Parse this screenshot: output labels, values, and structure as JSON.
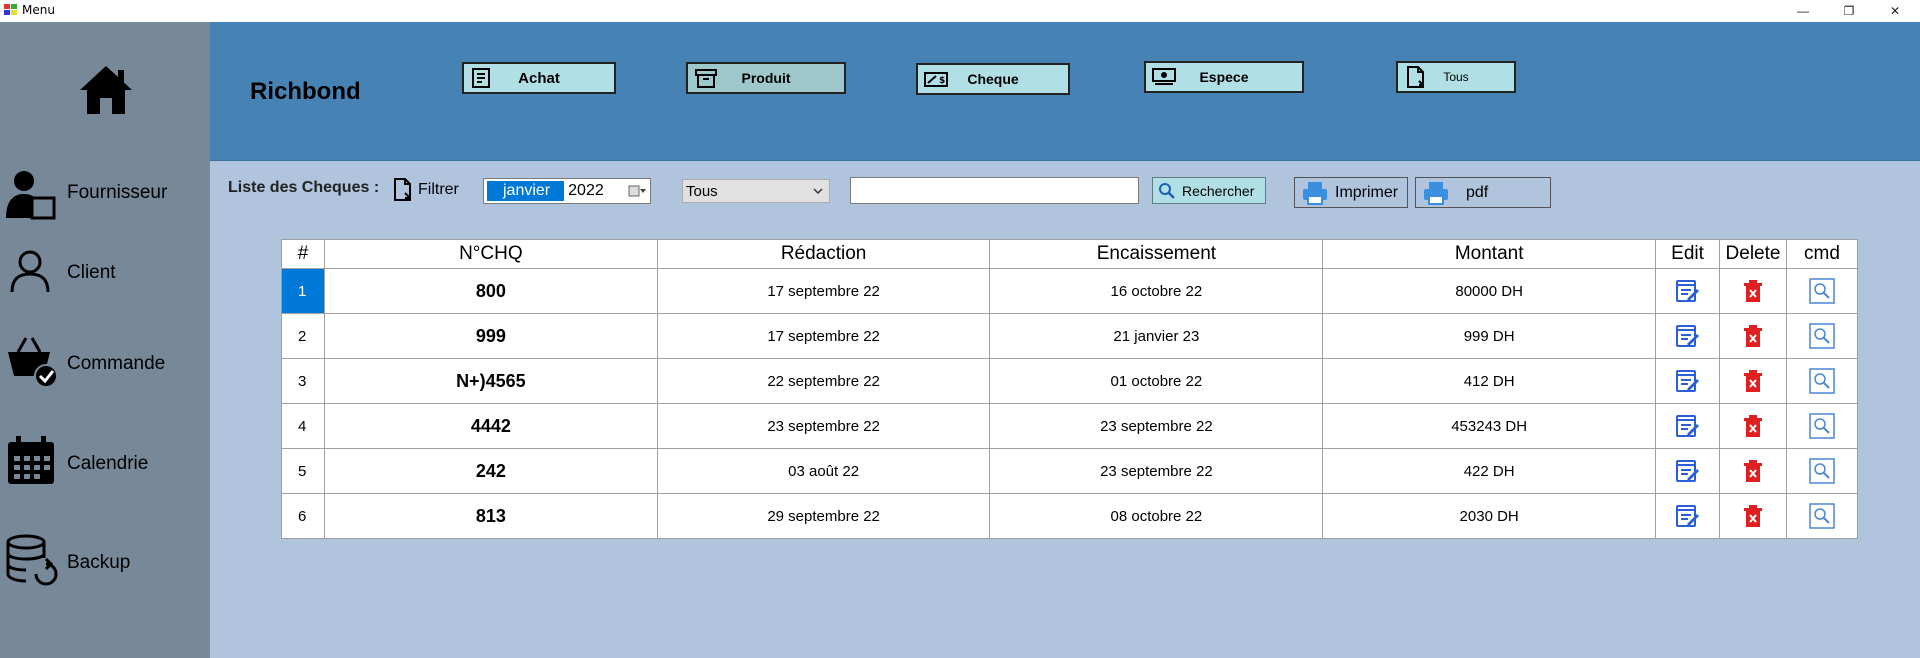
{
  "window": {
    "title": "Menu",
    "controls": [
      "—",
      "❐",
      "✕"
    ]
  },
  "sidebar": {
    "home_icon": "home-icon",
    "items": [
      {
        "label": "Fournisseur",
        "icon": "supplier-icon"
      },
      {
        "label": "Client",
        "icon": "user-icon"
      },
      {
        "label": "Commande",
        "icon": "basket-check-icon"
      },
      {
        "label": "Calendrie",
        "icon": "calendar-icon"
      },
      {
        "label": "Backup",
        "icon": "database-sync-icon"
      }
    ]
  },
  "header": {
    "brand": "Richbond",
    "buttons": [
      {
        "label": "Achat",
        "icon": "receipt-icon",
        "active": false
      },
      {
        "label": "Produit",
        "icon": "archive-icon",
        "active": true
      },
      {
        "label": "Cheque",
        "icon": "cheque-icon",
        "active": false
      },
      {
        "label": "Espece",
        "icon": "cash-icon",
        "active": false
      },
      {
        "label": "Tous",
        "icon": "document-icon",
        "active": false
      }
    ]
  },
  "toolbar": {
    "list_label": "Liste des Cheques :",
    "filter_label": "Filtrer",
    "date": {
      "month": "janvier",
      "year": "2022"
    },
    "type_select": "Tous",
    "search_value": "",
    "search_button": "Rechercher",
    "print_button": "Imprimer",
    "pdf_button": "pdf"
  },
  "grid": {
    "columns": [
      "#",
      "N°CHQ",
      "Rédaction",
      "Encaissement",
      "Montant",
      "Edit",
      "Delete",
      "cmd"
    ],
    "rows": [
      {
        "idx": "1",
        "num": "800",
        "redaction": "17 septembre 22",
        "encaissement": "16 octobre 22",
        "montant": "80000 DH"
      },
      {
        "idx": "2",
        "num": "999",
        "redaction": "17 septembre 22",
        "encaissement": "21 janvier 23",
        "montant": "999 DH"
      },
      {
        "idx": "3",
        "num": "N+)4565",
        "redaction": "22 septembre 22",
        "encaissement": "01 octobre 22",
        "montant": "412 DH"
      },
      {
        "idx": "4",
        "num": "4442",
        "redaction": "23 septembre 22",
        "encaissement": "23 septembre 22",
        "montant": "453243 DH"
      },
      {
        "idx": "5",
        "num": "242",
        "redaction": "03 août 22",
        "encaissement": "23 septembre 22",
        "montant": "422 DH"
      },
      {
        "idx": "6",
        "num": "813",
        "redaction": "29 septembre 22",
        "encaissement": "08 octobre 22",
        "montant": "2030 DH"
      }
    ],
    "selected_row": "1"
  },
  "colors": {
    "header_bg": "#4682b4",
    "sidebar_bg": "#778899",
    "page_bg": "#b0c4de",
    "button_bg": "#b0e0e6",
    "selection": "#0078d7",
    "delete_red": "#e02020",
    "edit_blue": "#2b5fd9"
  }
}
